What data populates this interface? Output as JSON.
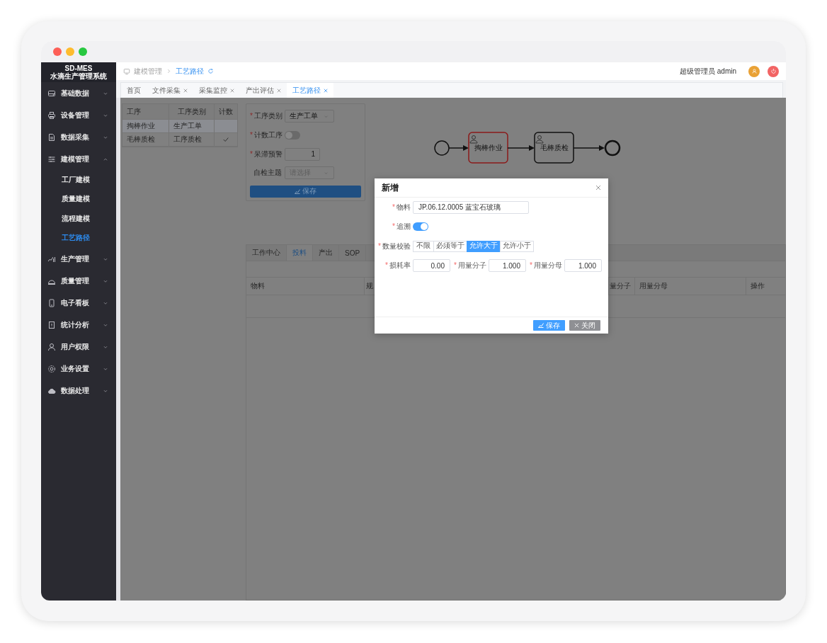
{
  "sidebar": {
    "logo": {
      "title": "SD-MES",
      "subtitle": "水滴生产管理系统"
    },
    "items": [
      {
        "label": "基础数据",
        "expanded": false
      },
      {
        "label": "设备管理",
        "expanded": false
      },
      {
        "label": "数据采集",
        "expanded": false
      },
      {
        "label": "建模管理",
        "expanded": true,
        "children": [
          {
            "label": "工厂建模",
            "selected": false
          },
          {
            "label": "质量建模",
            "selected": false
          },
          {
            "label": "流程建模",
            "selected": false
          },
          {
            "label": "工艺路径",
            "selected": true
          }
        ]
      },
      {
        "label": "生产管理",
        "expanded": false
      },
      {
        "label": "质量管理",
        "expanded": false
      },
      {
        "label": "电子看板",
        "expanded": false
      },
      {
        "label": "统计分析",
        "expanded": false
      },
      {
        "label": "用户权限",
        "expanded": false
      },
      {
        "label": "业务设置",
        "expanded": false
      },
      {
        "label": "数据处理",
        "expanded": false
      }
    ]
  },
  "header": {
    "breadcrumb": [
      {
        "label": "建模管理",
        "current": false
      },
      {
        "label": "工艺路径",
        "current": true
      }
    ],
    "user": "超级管理员 admin"
  },
  "tabs": [
    {
      "label": "首页",
      "closable": false,
      "selected": false
    },
    {
      "label": "文件采集",
      "closable": true,
      "selected": false
    },
    {
      "label": "采集监控",
      "closable": true,
      "selected": false
    },
    {
      "label": "产出评估",
      "closable": true,
      "selected": false
    },
    {
      "label": "工艺路径",
      "closable": true,
      "selected": true
    }
  ],
  "process_table": {
    "columns": [
      "工序",
      "工序类别",
      "计数"
    ],
    "rows": [
      {
        "cells": [
          "掏棒作业",
          "生产工单"
        ],
        "counted": false,
        "selected": true
      },
      {
        "cells": [
          "毛棒质检",
          "工序质检"
        ],
        "counted": true,
        "selected": false
      }
    ]
  },
  "process_form": {
    "fields": [
      {
        "kind": "select",
        "required_mark": "*",
        "label": "工序类别",
        "value": "生产工单"
      },
      {
        "kind": "toggle",
        "required_mark": "*",
        "label": "计数工序",
        "on": false
      },
      {
        "kind": "number",
        "required_mark": "*",
        "label": "呆滞预警",
        "value": "1"
      },
      {
        "kind": "select",
        "label": "自检主题",
        "placeholder": "请选择"
      }
    ],
    "save_button": "保存"
  },
  "flow_diagram": {
    "tasks": [
      {
        "label": "掏棒作业",
        "selected": true
      },
      {
        "label": "毛棒质检",
        "selected": false
      }
    ]
  },
  "detail_tabs": [
    {
      "label": "工作中心",
      "selected": false
    },
    {
      "label": "投料",
      "selected": true
    },
    {
      "label": "产出",
      "selected": false
    },
    {
      "label": "SOP",
      "selected": false
    }
  ],
  "detail_table": {
    "columns": [
      "物料",
      "规",
      "量分子",
      "用量分母",
      "操作"
    ]
  },
  "dialog": {
    "title": "新增",
    "rows": [
      {
        "kind": "text",
        "required_mark": "*",
        "label": "物料",
        "value": "JP.06.12.0005 蓝宝石玻璃"
      },
      {
        "kind": "toggle",
        "required_mark": "*",
        "label": "追溯",
        "on": true
      },
      {
        "kind": "segmented",
        "required_mark": "*",
        "label": "数量校验",
        "options": [
          {
            "label": "不限",
            "selected": false
          },
          {
            "label": "必须等于",
            "selected": false
          },
          {
            "label": "允许大于",
            "selected": true
          },
          {
            "label": "允许小于",
            "selected": false
          }
        ]
      },
      {
        "kind": "numbers",
        "items": [
          {
            "required_mark": "*",
            "label": "损耗率",
            "value": "0.00"
          },
          {
            "required_mark": "*",
            "label": "用量分子",
            "value": "1.000"
          },
          {
            "required_mark": "*",
            "label": "用量分母",
            "value": "1.000"
          }
        ]
      }
    ],
    "buttons": [
      {
        "kind": "primary",
        "label": "保存"
      },
      {
        "kind": "secondary",
        "label": "关闭"
      }
    ]
  }
}
